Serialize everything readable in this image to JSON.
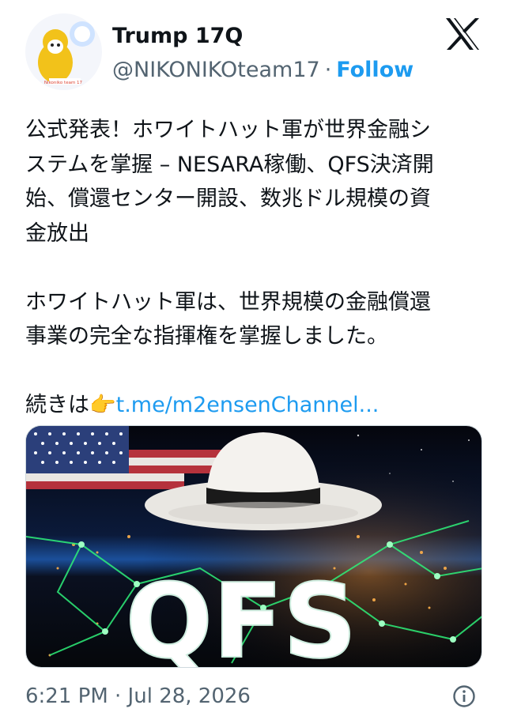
{
  "author": {
    "display_name": "Trump 17Q",
    "handle": "@NIKONIKOteam17",
    "separator": "·",
    "follow_label": "Follow",
    "avatar_caption": "Nikoniko team 17"
  },
  "platform_icon": "x-logo-icon",
  "post": {
    "line1": "公式発表！ホワイトハット軍が世界金融シ",
    "line2": "ステムを掌握 – NESARA稼働、QFS決済開",
    "line3": "始、償還センター開設、数兆ドル規模の資",
    "line4": "金放出",
    "line5": "ホワイトハット軍は、世界規模の金融償還",
    "line6": "事業の完全な指揮権を掌握しました。",
    "continue_label": "続きは",
    "pointing_emoji": "👉",
    "link_text": "t.me/m2ensenChannel..."
  },
  "media": {
    "overlay_text": "QFS",
    "description_icon": "white-hat-globe-network-image"
  },
  "meta": {
    "timestamp": "6:21 PM · Jul 28, 2026",
    "info_icon": "info-icon"
  },
  "colors": {
    "accent": "#1d9bf0",
    "secondary_text": "#536471",
    "primary_text": "#0f1419"
  }
}
